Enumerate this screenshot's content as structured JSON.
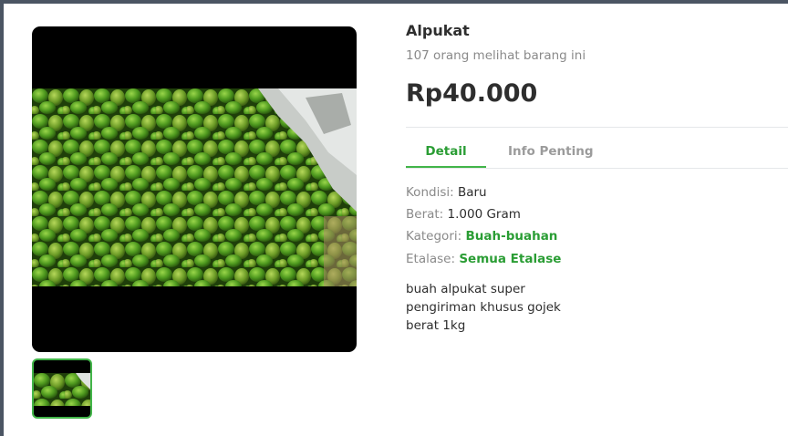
{
  "product": {
    "title": "Alpukat",
    "viewers": "107 orang melihat barang ini",
    "price": "Rp40.000"
  },
  "tabs": [
    {
      "label": "Detail",
      "active": true
    },
    {
      "label": "Info Penting",
      "active": false
    }
  ],
  "details": {
    "kondisi_label": "Kondisi: ",
    "kondisi_value": "Baru",
    "berat_label": "Berat: ",
    "berat_value": "1.000 Gram",
    "kategori_label": "Kategori: ",
    "kategori_value": "Buah-buahan",
    "etalase_label": "Etalase: ",
    "etalase_value": "Semua Etalase"
  },
  "description": [
    "buah alpukat super",
    "pengiriman khusus gojek",
    "berat 1kg"
  ],
  "colors": {
    "accent": "#42b549",
    "link": "#2a9d34",
    "text": "#2e2e2e",
    "muted": "#8a8a8a"
  },
  "icons": {
    "main_image": "avocado-pile-photo",
    "thumbnail": "avocado-pile-thumbnail"
  }
}
